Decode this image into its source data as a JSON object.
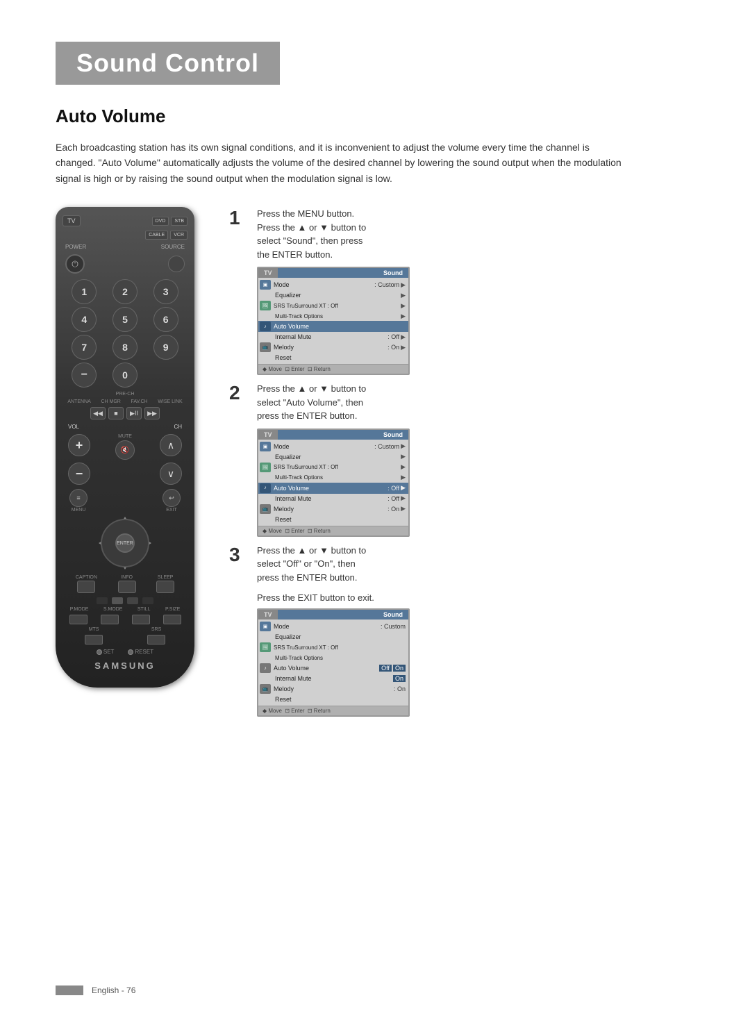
{
  "page": {
    "title": "Sound Control",
    "section": "Auto Volume",
    "intro": "Each broadcasting station has its own signal conditions, and it is inconvenient to adjust the volume every time the channel is changed. \"Auto Volume\" automatically adjusts the volume of the desired channel by lowering the sound output when the modulation signal is high or by raising the sound output when the modulation signal is low.",
    "footer_text": "English - 76"
  },
  "remote": {
    "brand": "SAMSUNG",
    "tv_label": "TV",
    "dvd_label": "DVD",
    "stb_label": "STB",
    "cable_label": "CABLE",
    "vcr_label": "VCR",
    "power_label": "POWER",
    "source_label": "SOURCE",
    "numbers": [
      "1",
      "2",
      "3",
      "4",
      "5",
      "6",
      "7",
      "8",
      "9",
      "–",
      "0"
    ],
    "pre_ch_label": "PRE-CH",
    "antenna_label": "ANTENNA",
    "ch_mgr_label": "CH MGR",
    "fav_ch_label": "FAV.CH",
    "wise_link_label": "WISE LINK",
    "vol_label": "VOL",
    "ch_label": "CH",
    "mute_label": "MUTE",
    "menu_label": "MENU",
    "exit_label": "EXIT",
    "enter_label": "ENTER",
    "caption_label": "CAPTION",
    "info_label": "INFO",
    "sleep_label": "SLEEP",
    "p_mode_label": "P.MODE",
    "s_mode_label": "S.MODE",
    "still_label": "STILL",
    "p_size_label": "P.SIZE",
    "mts_label": "MTS",
    "srs_label": "SRS",
    "set_label": "SET",
    "reset_label": "RESET"
  },
  "steps": [
    {
      "number": "1",
      "lines": [
        "Press the MENU button.",
        "Press the ▲ or ▼ button to",
        "select \"Sound\", then press",
        "the ENTER button."
      ],
      "screen": {
        "tv_label": "TV",
        "sound_label": "Sound",
        "rows": [
          {
            "icon": "input",
            "label": "Mode",
            "value": ": Custom",
            "arrow": "▶",
            "highlighted": false
          },
          {
            "icon": null,
            "label": "Equalizer",
            "value": "",
            "arrow": "▶",
            "highlighted": false,
            "indent": true
          },
          {
            "icon": "picture",
            "label": "SRS TruSurround XT : Off",
            "value": "",
            "arrow": "▶",
            "highlighted": false
          },
          {
            "icon": null,
            "label": "Multi-Track Options",
            "value": "",
            "arrow": "▶",
            "highlighted": false,
            "indent": true
          },
          {
            "icon": "sound",
            "label": "Auto Volume",
            "value": "",
            "arrow": "",
            "highlighted": true
          },
          {
            "icon": null,
            "label": "Internal Mute",
            "value": ": Off",
            "arrow": "▶",
            "highlighted": false,
            "indent": true
          },
          {
            "icon": "channel",
            "label": "Melody",
            "value": ": On",
            "arrow": "▶",
            "highlighted": false
          },
          {
            "icon": null,
            "label": "Reset",
            "value": "",
            "arrow": "",
            "highlighted": false,
            "indent": true
          }
        ],
        "footer": "◆ Move  ⊡ Enter  ⊡ Return"
      }
    },
    {
      "number": "2",
      "lines": [
        "Press the ▲ or ▼ button to",
        "select \"Auto Volume\", then",
        "press the ENTER button."
      ],
      "screen": {
        "tv_label": "TV",
        "sound_label": "Sound",
        "rows": [
          {
            "icon": "input",
            "label": "Mode",
            "value": ": Custom",
            "arrow": "▶",
            "highlighted": false
          },
          {
            "icon": null,
            "label": "Equalizer",
            "value": "",
            "arrow": "▶",
            "highlighted": false,
            "indent": true
          },
          {
            "icon": "picture",
            "label": "SRS TruSurround XT : Off",
            "value": "",
            "arrow": "▶",
            "highlighted": false
          },
          {
            "icon": null,
            "label": "Multi-Track Options",
            "value": "",
            "arrow": "▶",
            "highlighted": false,
            "indent": true
          },
          {
            "icon": "sound",
            "label": "Auto Volume",
            "value": ": Off",
            "arrow": "▶",
            "highlighted": true
          },
          {
            "icon": null,
            "label": "Internal Mute",
            "value": ": Off",
            "arrow": "▶",
            "highlighted": false,
            "indent": true
          },
          {
            "icon": "channel",
            "label": "Melody",
            "value": ": On",
            "arrow": "▶",
            "highlighted": false
          },
          {
            "icon": null,
            "label": "Reset",
            "value": "",
            "arrow": "",
            "highlighted": false,
            "indent": true
          }
        ],
        "footer": "◆ Move  ⊡ Enter  ⊡ Return"
      }
    },
    {
      "number": "3",
      "lines": [
        "Press the ▲ or ▼ button to",
        "select \"Off\" or \"On\", then",
        "press the ENTER button."
      ],
      "exit_note": "Press the EXIT button to exit.",
      "screen": {
        "tv_label": "TV",
        "sound_label": "Sound",
        "rows": [
          {
            "icon": "input",
            "label": "Mode",
            "value": ": Custom",
            "arrow": "",
            "highlighted": false
          },
          {
            "icon": null,
            "label": "Equalizer",
            "value": "",
            "arrow": "",
            "highlighted": false,
            "indent": true
          },
          {
            "icon": "picture",
            "label": "SRS TruSurround XT : Off",
            "value": "",
            "arrow": "",
            "highlighted": false
          },
          {
            "icon": null,
            "label": "Multi-Track Options",
            "value": "",
            "arrow": "",
            "highlighted": false,
            "indent": true
          },
          {
            "icon": "sound",
            "label": "Auto Volume",
            "value": "",
            "arrow": "",
            "highlighted": false,
            "options": [
              "Off",
              "On"
            ]
          },
          {
            "icon": null,
            "label": "Internal Mute",
            "value": "",
            "arrow": "",
            "highlighted": false,
            "options_inline": "On",
            "indent": true
          },
          {
            "icon": "channel",
            "label": "Melody",
            "value": ": On",
            "arrow": "",
            "highlighted": false
          },
          {
            "icon": null,
            "label": "Reset",
            "value": "",
            "arrow": "",
            "highlighted": false,
            "indent": true
          }
        ],
        "footer": "◆ Move  ⊡ Enter  ⊡ Return"
      }
    }
  ]
}
